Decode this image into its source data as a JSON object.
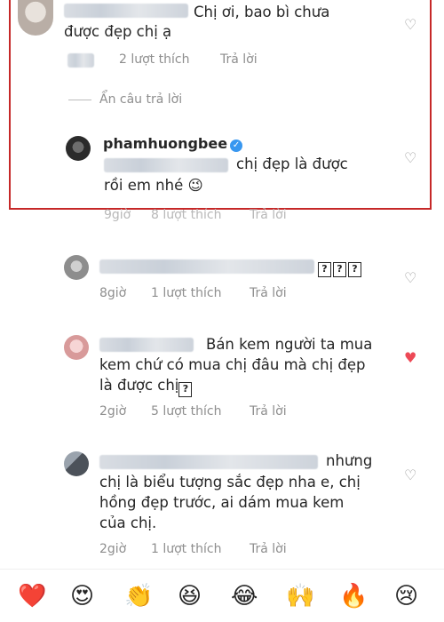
{
  "comments": [
    {
      "text": "Chị ơi, bao bì chưa được đẹp chị ạ",
      "text_line1": "Chị ơi, bao bì chưa",
      "text_line2": "được đẹp chị ạ",
      "likes": "2 lượt thích",
      "reply_label": "Trả lời",
      "liked": false
    },
    {
      "toggle_replies": "Ẩn câu trả lời",
      "username": "phamhuongbee",
      "text_line1": "chị đẹp là được",
      "text_line2": "rồi em nhé 😉",
      "time": "9giờ",
      "likes": "8 lượt thích",
      "reply_label": "Trả lời",
      "liked": false
    },
    {
      "marks": "???",
      "time": "8giờ",
      "likes": "1 lượt thích",
      "reply_label": "Trả lời",
      "liked": false
    },
    {
      "text_line1": "Bán kem người ta mua",
      "text_line2": "kem chứ có mua chị đâu mà chị đẹp",
      "text_line3": "là được chị",
      "marks": "?",
      "time": "2giờ",
      "likes": "5 lượt thích",
      "reply_label": "Trả lời",
      "liked": true
    },
    {
      "text_line1": "nhưng",
      "text_line2": "chị là biểu tượng sắc đẹp nha e, chị",
      "text_line3": "hồng đẹp trước, ai dám mua kem",
      "text_line4": "của chị.",
      "time": "2giờ",
      "likes": "1 lượt thích",
      "reply_label": "Trả lời",
      "liked": false
    }
  ],
  "icons": {
    "heart_outline": "♡",
    "heart_filled": "♥",
    "verified": "✓"
  },
  "emoji_bar": [
    "❤️",
    "😍",
    "👏",
    "😆",
    "😂",
    "🙌",
    "🔥",
    "😢"
  ],
  "colors": {
    "highlight": "#c62828",
    "liked": "#ed4956",
    "meta": "#8e8e8e",
    "verified": "#3897f0"
  }
}
